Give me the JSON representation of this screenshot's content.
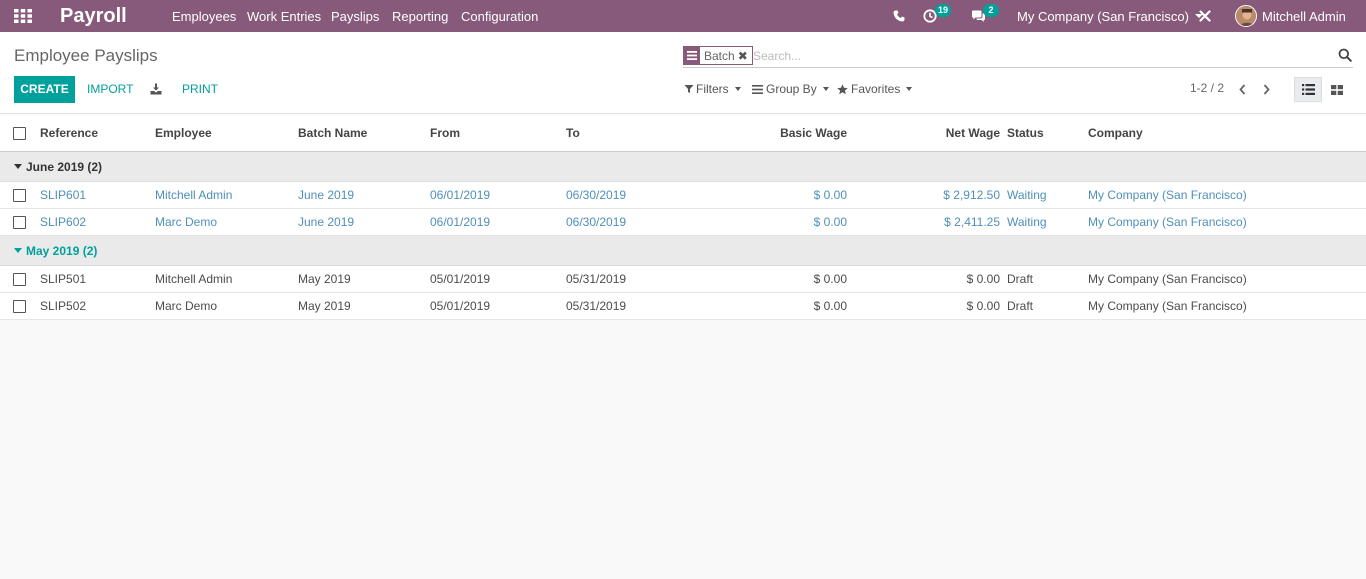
{
  "navbar": {
    "brand": "Payroll",
    "menu": [
      "Employees",
      "Work Entries",
      "Payslips",
      "Reporting",
      "Configuration"
    ],
    "activity_count": "19",
    "message_count": "2",
    "company": "My Company (San Francisco)",
    "user": "Mitchell Admin",
    "color": "#875a7b"
  },
  "control": {
    "title": "Employee Payslips",
    "create_label": "CREATE",
    "import_label": "IMPORT",
    "print_label": "PRINT",
    "facet_label": "Batch",
    "search_placeholder": "Search...",
    "filters_label": "Filters",
    "groupby_label": "Group By",
    "favorites_label": "Favorites",
    "pager": "1-2 / 2",
    "accent": "#00a09d"
  },
  "table": {
    "columns": [
      "Reference",
      "Employee",
      "Batch Name",
      "From",
      "To",
      "Basic Wage",
      "Net Wage",
      "Status",
      "Company"
    ],
    "groups": [
      {
        "label": "June 2019 (2)",
        "rows": [
          [
            "SLIP601",
            "Mitchell Admin",
            "June 2019",
            "06/01/2019",
            "06/30/2019",
            "$ 0.00",
            "$ 2,912.50",
            "Waiting",
            "My Company (San Francisco)"
          ],
          [
            "SLIP602",
            "Marc Demo",
            "June 2019",
            "06/01/2019",
            "06/30/2019",
            "$ 0.00",
            "$ 2,411.25",
            "Waiting",
            "My Company (San Francisco)"
          ]
        ]
      },
      {
        "label": "May 2019 (2)",
        "rows": [
          [
            "SLIP501",
            "Mitchell Admin",
            "May 2019",
            "05/01/2019",
            "05/31/2019",
            "$ 0.00",
            "$ 0.00",
            "Draft",
            "My Company (San Francisco)"
          ],
          [
            "SLIP502",
            "Marc Demo",
            "May 2019",
            "05/01/2019",
            "05/31/2019",
            "$ 0.00",
            "$ 0.00",
            "Draft",
            "My Company (San Francisco)"
          ]
        ]
      }
    ]
  }
}
